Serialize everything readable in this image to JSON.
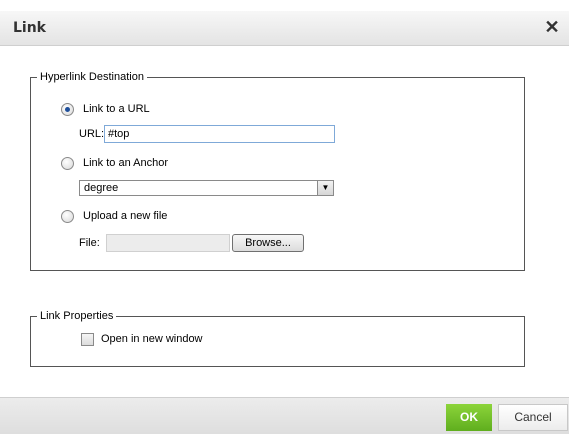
{
  "dialog": {
    "title": "Link",
    "close_glyph": "✕"
  },
  "hyperlink": {
    "legend": "Hyperlink Destination",
    "option_url": {
      "label": "Link to a URL",
      "checked": true
    },
    "url_label": "URL:",
    "url_value": "#top",
    "option_anchor": {
      "label": "Link to an Anchor",
      "checked": false
    },
    "anchor_selected": "degree",
    "option_upload": {
      "label": "Upload a new file",
      "checked": false
    },
    "file_label": "File:",
    "browse_label": "Browse..."
  },
  "properties": {
    "legend": "Link Properties",
    "new_window_label": "Open in new window",
    "new_window_checked": false
  },
  "footer": {
    "ok_label": "OK",
    "cancel_label": "Cancel"
  },
  "colors": {
    "ok_green": "#6cc226",
    "input_border": "#7fa9d8"
  }
}
